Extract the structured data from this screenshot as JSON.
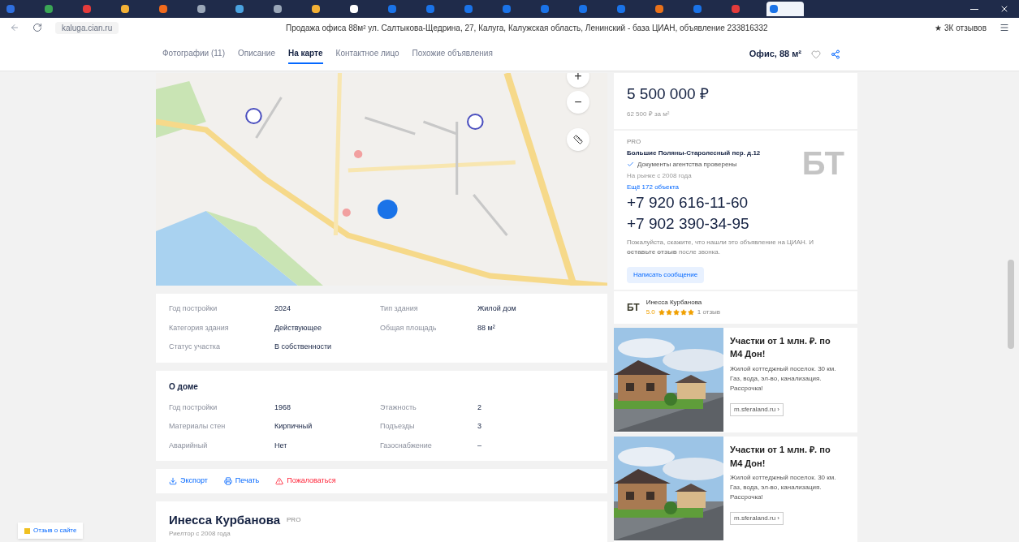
{
  "browser": {
    "tabs": [
      {
        "color": "#2f6fde",
        "selected": false
      },
      {
        "color": "#3aa655",
        "selected": false
      },
      {
        "color": "#e33b3b",
        "selected": false
      },
      {
        "color": "#f2b035",
        "selected": false
      },
      {
        "color": "#f06a1c",
        "selected": false
      },
      {
        "color": "#9aa7b8",
        "selected": false
      },
      {
        "color": "#4aa3e0",
        "selected": false
      },
      {
        "color": "#9aa7b8",
        "selected": false
      },
      {
        "color": "#f2b035",
        "selected": false
      },
      {
        "color": "#ffffff",
        "selected": false
      },
      {
        "color": "#1a73e8",
        "selected": false
      },
      {
        "color": "#1a73e8",
        "selected": false
      },
      {
        "color": "#1a73e8",
        "selected": false
      },
      {
        "color": "#1a73e8",
        "selected": false
      },
      {
        "color": "#1a73e8",
        "selected": false
      },
      {
        "color": "#1a73e8",
        "selected": false
      },
      {
        "color": "#1a73e8",
        "selected": false
      },
      {
        "color": "#e8711a",
        "selected": false
      },
      {
        "color": "#1a73e8",
        "selected": false
      },
      {
        "color": "#e33b3b",
        "selected": false
      },
      {
        "color": "#1a73e8",
        "selected": true
      }
    ],
    "address": "kaluga.cian.ru",
    "page_title": "Продажа офиса 88м² ул. Салтыкова-Щедрина, 27, Калуга, Калужская область, Ленинский - база ЦИАН, объявление 233816332",
    "reviews": "★ 3К отзывов"
  },
  "nav": {
    "items": [
      {
        "label": "Фотографии (11)",
        "selected": false
      },
      {
        "label": "Описание",
        "selected": false
      },
      {
        "label": "На карте",
        "selected": true
      },
      {
        "label": "Контактное лицо",
        "selected": false
      },
      {
        "label": "Похожие объявления",
        "selected": false
      }
    ],
    "summary": "Офис, 88 м²"
  },
  "map": {
    "zoom_in": "+",
    "zoom_out": "−"
  },
  "details": [
    {
      "label": "Год постройки",
      "value": "2024"
    },
    {
      "label": "Тип здания",
      "value": "Жилой дом"
    },
    {
      "label": "Категория здания",
      "value": "Действующее"
    },
    {
      "label": "Общая площадь",
      "value": "88 м²"
    },
    {
      "label": "Статус участка",
      "value": "В собственности"
    }
  ],
  "house": {
    "title": "О доме",
    "rows": [
      {
        "label": "Год постройки",
        "value": "1968"
      },
      {
        "label": "Этажность",
        "value": "2"
      },
      {
        "label": "Материалы стен",
        "value": "Кирпичный"
      },
      {
        "label": "Подъезды",
        "value": "3"
      },
      {
        "label": "Аварийный",
        "value": "Нет"
      },
      {
        "label": "Газоснабжение",
        "value": "–"
      }
    ]
  },
  "actions": [
    {
      "label": "Экспорт",
      "kind": "export"
    },
    {
      "label": "Печать",
      "kind": "print"
    },
    {
      "label": "Пожаловаться",
      "kind": "report"
    }
  ],
  "agent_card": {
    "name": "Инесса Курбанова",
    "badge": "PRO",
    "subtitle": "Риелтор с 2008 года"
  },
  "feedback": "Отзыв о сайте",
  "price": {
    "amount": "5 500 000 ₽",
    "per_meter": "62 500 ₽ за м²"
  },
  "agency": {
    "badge": "PRO",
    "name": "Большие Поляны-Старолесный пер. д.12",
    "verified": "Документы агентства проверены",
    "since": "На рынке с 2008 года",
    "more": "Ещё 172 объекта",
    "logo_text": "БТ",
    "phones": [
      "+7 920 616-11-60",
      "+7 902 390-34-95"
    ],
    "note": "Пожалуйста, скажите, что нашли это объявление на ЦИАН. И **оставьте отзыв** после звонка.",
    "message_button": "Написать сообщение"
  },
  "author": {
    "logo_text": "БТ",
    "name": "Инесса Курбанова",
    "rating": "5.0",
    "stars": 5,
    "reviews": "1 отзыв"
  },
  "ads": [
    {
      "title": "Участки от 1 млн. ₽. по М4 Дон!",
      "text": "Жилой коттеджный поселок. 30 км. Газ, вода, эл-во, канализация. Рассрочка!",
      "link": "m.sferaland.ru ›"
    },
    {
      "title": "Участки от 1 млн. ₽. по М4 Дон!",
      "text": "Жилой коттеджный поселок. 30 км. Газ, вода, эл-во, канализация. Рассрочка!",
      "link": "m.sferaland.ru ›"
    }
  ]
}
